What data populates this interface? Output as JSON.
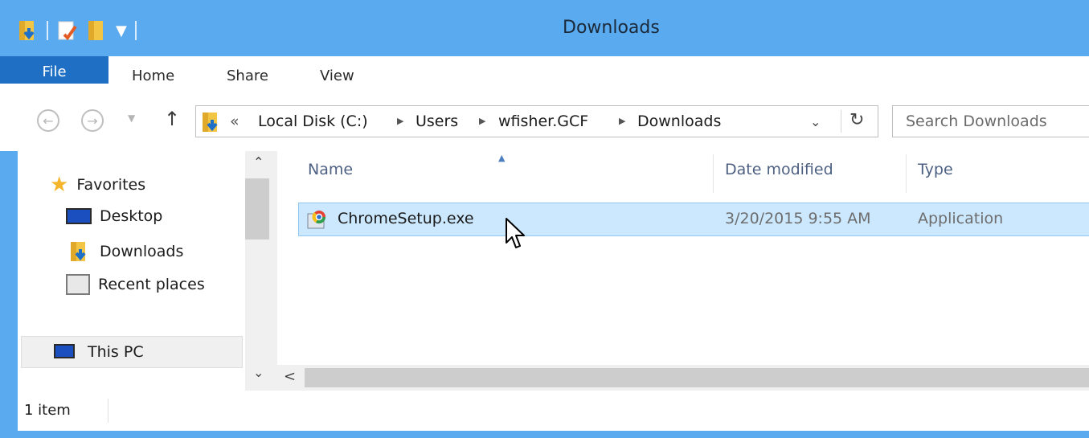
{
  "window": {
    "title": "Downloads",
    "accent_color": "#5aaaf0"
  },
  "ribbon": {
    "tabs": [
      "File",
      "Home",
      "Share",
      "View"
    ]
  },
  "address": {
    "overflow": "«",
    "crumbs": [
      "Local Disk (C:)",
      "Users",
      "wfisher.GCF",
      "Downloads"
    ],
    "search_placeholder": "Search Downloads"
  },
  "nav": {
    "favorites": "Favorites",
    "items": [
      "Desktop",
      "Downloads",
      "Recent places"
    ],
    "this_pc": "This PC"
  },
  "columns": [
    "Name",
    "Date modified",
    "Type"
  ],
  "files": [
    {
      "name": "ChromeSetup.exe",
      "date": "3/20/2015 9:55 AM",
      "type": "Application"
    }
  ],
  "status": {
    "count": "1 item"
  }
}
